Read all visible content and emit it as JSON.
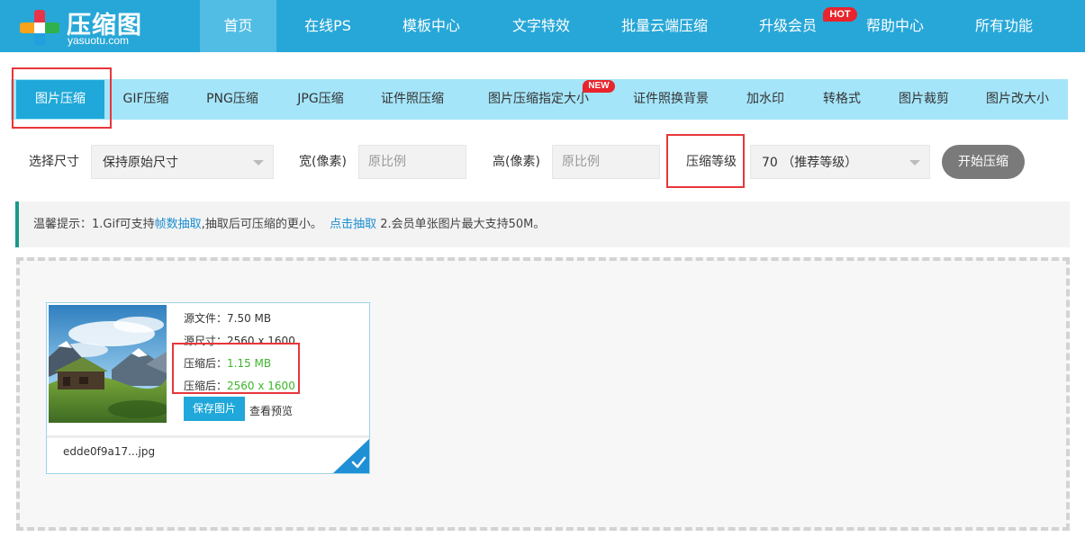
{
  "brand": {
    "title": "压缩图",
    "subtitle": "yasuotu.com",
    "colors": {
      "primary": "#27a7d8",
      "tab_bg": "#a5e5f9",
      "accent_red": "#e8242c",
      "success_green": "#3db629"
    }
  },
  "nav": {
    "items": [
      {
        "label": "首页"
      },
      {
        "label": "在线PS"
      },
      {
        "label": "模板中心"
      },
      {
        "label": "文字特效"
      },
      {
        "label": "批量云端压缩"
      },
      {
        "label": "升级会员"
      },
      {
        "label": "帮助中心"
      },
      {
        "label": "所有功能"
      }
    ],
    "active_index": 0,
    "hot_badge": "HOT"
  },
  "tools": {
    "tabs": [
      {
        "label": "图片压缩"
      },
      {
        "label": "GIF压缩"
      },
      {
        "label": "PNG压缩"
      },
      {
        "label": "JPG压缩"
      },
      {
        "label": "证件照压缩"
      },
      {
        "label": "图片压缩指定大小"
      },
      {
        "label": "证件照换背景"
      },
      {
        "label": "加水印"
      },
      {
        "label": "转格式"
      },
      {
        "label": "图片裁剪"
      },
      {
        "label": "图片改大小"
      }
    ],
    "active_index": 0,
    "new_badge": "NEW"
  },
  "settings": {
    "size_label": "选择尺寸",
    "size_value": "保持原始尺寸",
    "width_label": "宽(像素)",
    "width_placeholder": "原比例",
    "height_label": "高(像素)",
    "height_placeholder": "原比例",
    "level_label": "压缩等级",
    "level_value": "70 （推荐等级）",
    "start_button": "开始压缩"
  },
  "tip": {
    "prefix": "温馨提示：1.Gif可支持",
    "link1": "帧数抽取",
    "middle": ",抽取后可压缩的更小。",
    "link2": "点击抽取",
    "suffix": " 2.会员单张图片最大支持50M。"
  },
  "file": {
    "source_size_label": "源文件：",
    "source_size": "7.50 MB",
    "source_dim_label": "源尺寸：",
    "source_dim": "2560 x 1600",
    "compressed_size_label": "压缩后：",
    "compressed_size": "1.15 MB",
    "compressed_dim_label": "压缩后：",
    "compressed_dim": "2560 x 1600",
    "save_button": "保存图片",
    "preview_link": "查看预览",
    "filename": "edde0f9a17...jpg"
  },
  "icons": {
    "logo": "cross-logo-icon",
    "dropdown": "caret-down-icon",
    "done": "checkmark-icon"
  }
}
